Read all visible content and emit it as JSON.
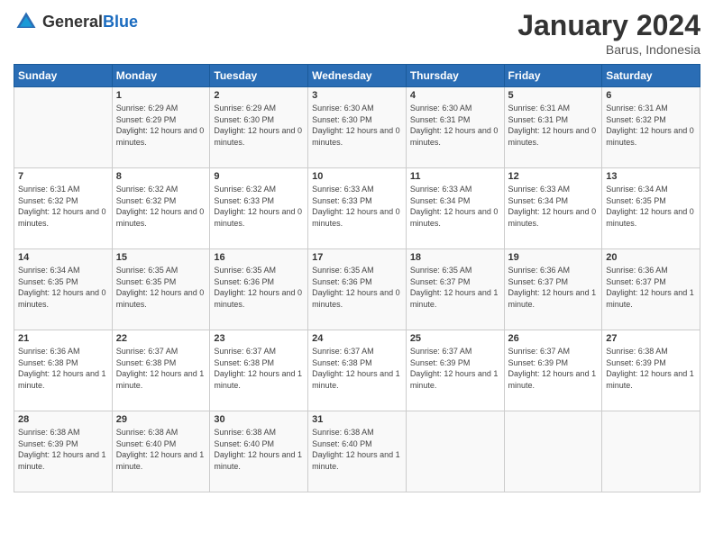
{
  "header": {
    "logo": {
      "general": "General",
      "blue": "Blue"
    },
    "month": "January 2024",
    "location": "Barus, Indonesia"
  },
  "weekdays": [
    "Sunday",
    "Monday",
    "Tuesday",
    "Wednesday",
    "Thursday",
    "Friday",
    "Saturday"
  ],
  "weeks": [
    [
      {
        "day": "",
        "sunrise": "",
        "sunset": "",
        "daylight": ""
      },
      {
        "day": "1",
        "sunrise": "Sunrise: 6:29 AM",
        "sunset": "Sunset: 6:29 PM",
        "daylight": "Daylight: 12 hours and 0 minutes."
      },
      {
        "day": "2",
        "sunrise": "Sunrise: 6:29 AM",
        "sunset": "Sunset: 6:30 PM",
        "daylight": "Daylight: 12 hours and 0 minutes."
      },
      {
        "day": "3",
        "sunrise": "Sunrise: 6:30 AM",
        "sunset": "Sunset: 6:30 PM",
        "daylight": "Daylight: 12 hours and 0 minutes."
      },
      {
        "day": "4",
        "sunrise": "Sunrise: 6:30 AM",
        "sunset": "Sunset: 6:31 PM",
        "daylight": "Daylight: 12 hours and 0 minutes."
      },
      {
        "day": "5",
        "sunrise": "Sunrise: 6:31 AM",
        "sunset": "Sunset: 6:31 PM",
        "daylight": "Daylight: 12 hours and 0 minutes."
      },
      {
        "day": "6",
        "sunrise": "Sunrise: 6:31 AM",
        "sunset": "Sunset: 6:32 PM",
        "daylight": "Daylight: 12 hours and 0 minutes."
      }
    ],
    [
      {
        "day": "7",
        "sunrise": "Sunrise: 6:31 AM",
        "sunset": "Sunset: 6:32 PM",
        "daylight": "Daylight: 12 hours and 0 minutes."
      },
      {
        "day": "8",
        "sunrise": "Sunrise: 6:32 AM",
        "sunset": "Sunset: 6:32 PM",
        "daylight": "Daylight: 12 hours and 0 minutes."
      },
      {
        "day": "9",
        "sunrise": "Sunrise: 6:32 AM",
        "sunset": "Sunset: 6:33 PM",
        "daylight": "Daylight: 12 hours and 0 minutes."
      },
      {
        "day": "10",
        "sunrise": "Sunrise: 6:33 AM",
        "sunset": "Sunset: 6:33 PM",
        "daylight": "Daylight: 12 hours and 0 minutes."
      },
      {
        "day": "11",
        "sunrise": "Sunrise: 6:33 AM",
        "sunset": "Sunset: 6:34 PM",
        "daylight": "Daylight: 12 hours and 0 minutes."
      },
      {
        "day": "12",
        "sunrise": "Sunrise: 6:33 AM",
        "sunset": "Sunset: 6:34 PM",
        "daylight": "Daylight: 12 hours and 0 minutes."
      },
      {
        "day": "13",
        "sunrise": "Sunrise: 6:34 AM",
        "sunset": "Sunset: 6:35 PM",
        "daylight": "Daylight: 12 hours and 0 minutes."
      }
    ],
    [
      {
        "day": "14",
        "sunrise": "Sunrise: 6:34 AM",
        "sunset": "Sunset: 6:35 PM",
        "daylight": "Daylight: 12 hours and 0 minutes."
      },
      {
        "day": "15",
        "sunrise": "Sunrise: 6:35 AM",
        "sunset": "Sunset: 6:35 PM",
        "daylight": "Daylight: 12 hours and 0 minutes."
      },
      {
        "day": "16",
        "sunrise": "Sunrise: 6:35 AM",
        "sunset": "Sunset: 6:36 PM",
        "daylight": "Daylight: 12 hours and 0 minutes."
      },
      {
        "day": "17",
        "sunrise": "Sunrise: 6:35 AM",
        "sunset": "Sunset: 6:36 PM",
        "daylight": "Daylight: 12 hours and 0 minutes."
      },
      {
        "day": "18",
        "sunrise": "Sunrise: 6:35 AM",
        "sunset": "Sunset: 6:37 PM",
        "daylight": "Daylight: 12 hours and 1 minute."
      },
      {
        "day": "19",
        "sunrise": "Sunrise: 6:36 AM",
        "sunset": "Sunset: 6:37 PM",
        "daylight": "Daylight: 12 hours and 1 minute."
      },
      {
        "day": "20",
        "sunrise": "Sunrise: 6:36 AM",
        "sunset": "Sunset: 6:37 PM",
        "daylight": "Daylight: 12 hours and 1 minute."
      }
    ],
    [
      {
        "day": "21",
        "sunrise": "Sunrise: 6:36 AM",
        "sunset": "Sunset: 6:38 PM",
        "daylight": "Daylight: 12 hours and 1 minute."
      },
      {
        "day": "22",
        "sunrise": "Sunrise: 6:37 AM",
        "sunset": "Sunset: 6:38 PM",
        "daylight": "Daylight: 12 hours and 1 minute."
      },
      {
        "day": "23",
        "sunrise": "Sunrise: 6:37 AM",
        "sunset": "Sunset: 6:38 PM",
        "daylight": "Daylight: 12 hours and 1 minute."
      },
      {
        "day": "24",
        "sunrise": "Sunrise: 6:37 AM",
        "sunset": "Sunset: 6:38 PM",
        "daylight": "Daylight: 12 hours and 1 minute."
      },
      {
        "day": "25",
        "sunrise": "Sunrise: 6:37 AM",
        "sunset": "Sunset: 6:39 PM",
        "daylight": "Daylight: 12 hours and 1 minute."
      },
      {
        "day": "26",
        "sunrise": "Sunrise: 6:37 AM",
        "sunset": "Sunset: 6:39 PM",
        "daylight": "Daylight: 12 hours and 1 minute."
      },
      {
        "day": "27",
        "sunrise": "Sunrise: 6:38 AM",
        "sunset": "Sunset: 6:39 PM",
        "daylight": "Daylight: 12 hours and 1 minute."
      }
    ],
    [
      {
        "day": "28",
        "sunrise": "Sunrise: 6:38 AM",
        "sunset": "Sunset: 6:39 PM",
        "daylight": "Daylight: 12 hours and 1 minute."
      },
      {
        "day": "29",
        "sunrise": "Sunrise: 6:38 AM",
        "sunset": "Sunset: 6:40 PM",
        "daylight": "Daylight: 12 hours and 1 minute."
      },
      {
        "day": "30",
        "sunrise": "Sunrise: 6:38 AM",
        "sunset": "Sunset: 6:40 PM",
        "daylight": "Daylight: 12 hours and 1 minute."
      },
      {
        "day": "31",
        "sunrise": "Sunrise: 6:38 AM",
        "sunset": "Sunset: 6:40 PM",
        "daylight": "Daylight: 12 hours and 1 minute."
      },
      {
        "day": "",
        "sunrise": "",
        "sunset": "",
        "daylight": ""
      },
      {
        "day": "",
        "sunrise": "",
        "sunset": "",
        "daylight": ""
      },
      {
        "day": "",
        "sunrise": "",
        "sunset": "",
        "daylight": ""
      }
    ]
  ]
}
